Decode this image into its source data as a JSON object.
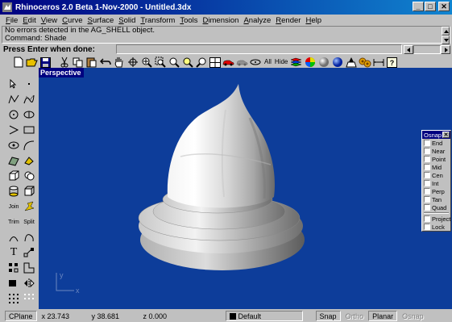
{
  "window": {
    "title": "Rhinoceros 2.0 Beta 1-Nov-2000 - Untitled.3dx",
    "controls": [
      "_",
      "□",
      "✕"
    ]
  },
  "menu": [
    "File",
    "Edit",
    "View",
    "Curve",
    "Surface",
    "Solid",
    "Transform",
    "Tools",
    "Dimension",
    "Analyze",
    "Render",
    "Help"
  ],
  "command_history": [
    "No errors detected in the AG_SHELL object.",
    "Command: Shade"
  ],
  "prompt": {
    "label": "Press Enter when done:",
    "value": ""
  },
  "toolbar": {
    "all_label": "All",
    "hide_label": "Hide"
  },
  "left_tools": {
    "join_label": "Join",
    "trim_label": "Trim",
    "split_label": "Split",
    "text_label": "T"
  },
  "viewport": {
    "title": "Perspective",
    "background": "#0d3d9a",
    "axis_labels": {
      "y": "y",
      "x": "x"
    }
  },
  "osnap": {
    "title": "Osnap",
    "close": "✕",
    "options": [
      "End",
      "Near",
      "Point",
      "Mid",
      "Cen",
      "Int",
      "Perp",
      "Tan",
      "Quad"
    ],
    "extra_options": [
      "Project",
      "Lock"
    ]
  },
  "status": {
    "cplane": "CPlane",
    "x": "x 23.743",
    "y": "y 38.681",
    "z": "z 0.000",
    "layer": "Default",
    "snap": "Snap",
    "ortho": "Ortho",
    "planar": "Planar",
    "osnap": "Osnap"
  }
}
